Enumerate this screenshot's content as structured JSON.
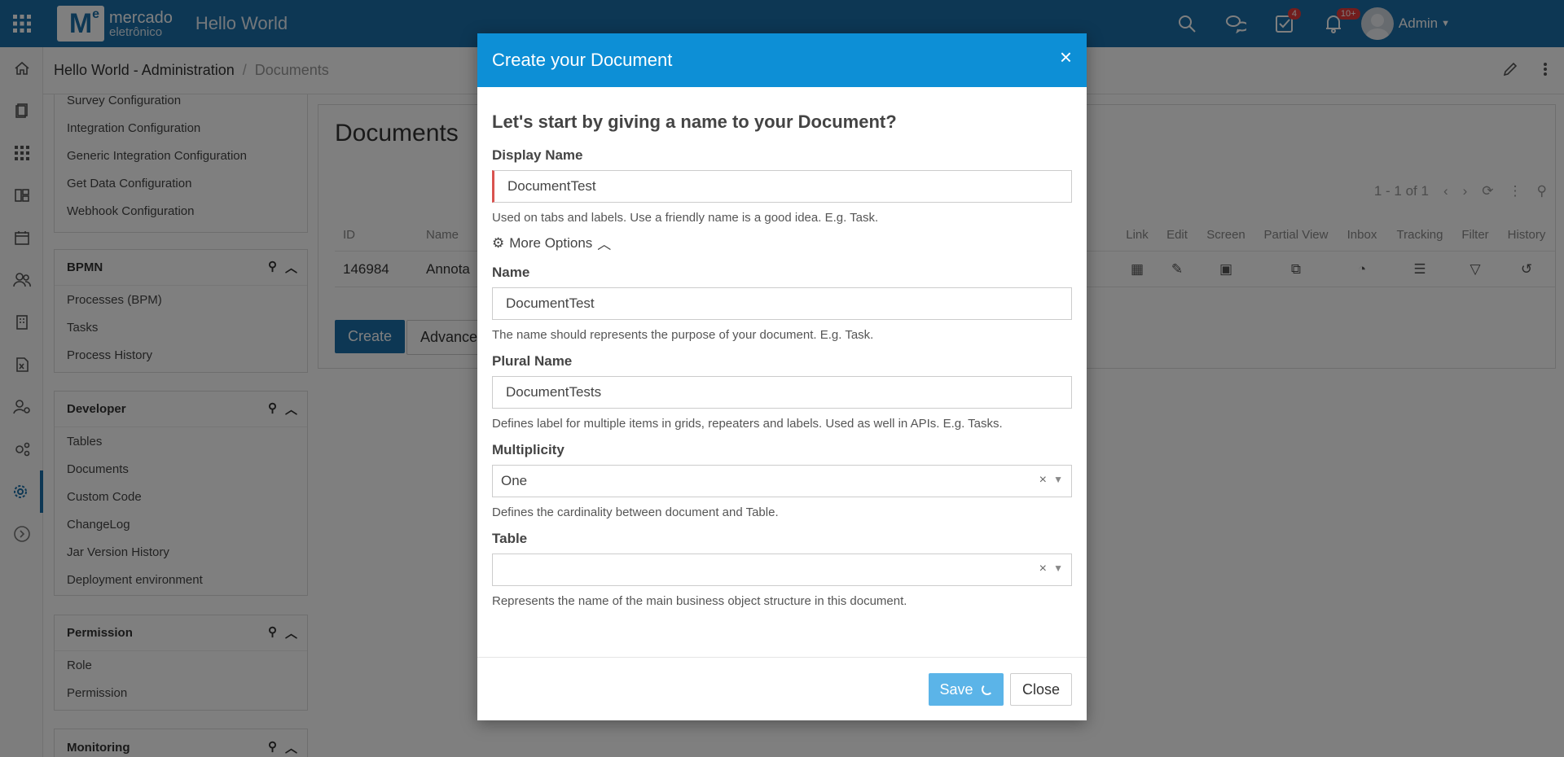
{
  "header": {
    "app_title": "Hello World",
    "logo": {
      "line1": "mercado",
      "line2": "eletrônico",
      "mark": "M",
      "mark_sup": "e"
    },
    "badges": {
      "tasks": "4",
      "notifications": "10+"
    },
    "user_name": "Admin"
  },
  "breadcrumb": {
    "parent": "Hello World - Administration",
    "current": "Documents"
  },
  "sidebar": {
    "config_items": [
      "Survey Configuration",
      "Integration Configuration",
      "Generic Integration Configuration",
      "Get Data Configuration",
      "Webhook Configuration"
    ],
    "bpmn": {
      "title": "BPMN",
      "items": [
        "Processes (BPM)",
        "Tasks",
        "Process History"
      ]
    },
    "developer": {
      "title": "Developer",
      "items": [
        "Tables",
        "Documents",
        "Custom Code",
        "ChangeLog",
        "Jar Version History",
        "Deployment environment"
      ]
    },
    "permission": {
      "title": "Permission",
      "items": [
        "Role",
        "Permission"
      ]
    },
    "monitoring": {
      "title": "Monitoring"
    }
  },
  "main": {
    "title": "Documents",
    "pager": "1 - 1 of 1",
    "columns": [
      "ID",
      "Name",
      "Link",
      "Edit",
      "Screen",
      "Partial View",
      "Inbox",
      "Tracking",
      "Filter",
      "History"
    ],
    "rows": [
      {
        "id": "146984",
        "name": "Annota"
      }
    ],
    "create_label": "Create",
    "advanced_label": "Advanced"
  },
  "modal": {
    "title": "Create your Document",
    "lead": "Let's start by giving a name to your Document?",
    "display_name": {
      "label": "Display Name",
      "value": "DocumentTest",
      "hint": "Used on tabs and labels. Use a friendly name is a good idea. E.g. Task."
    },
    "more_options": "More Options",
    "name": {
      "label": "Name",
      "value": "DocumentTest",
      "hint": "The name should represents the purpose of your document. E.g. Task."
    },
    "plural_name": {
      "label": "Plural Name",
      "value": "DocumentTests",
      "hint": "Defines label for multiple items in grids, repeaters and labels. Used as well in APIs. E.g. Tasks."
    },
    "multiplicity": {
      "label": "Multiplicity",
      "value": "One",
      "hint": "Defines the cardinality between document and Table."
    },
    "table": {
      "label": "Table",
      "value": "",
      "hint": "Represents the name of the main business object structure in this document."
    },
    "save_label": "Save",
    "close_label": "Close"
  },
  "colors": {
    "topbar": "#1b6fa8",
    "modal_header": "#0d8fd6",
    "save": "#5bb4e8",
    "invalid": "#d9534f"
  }
}
